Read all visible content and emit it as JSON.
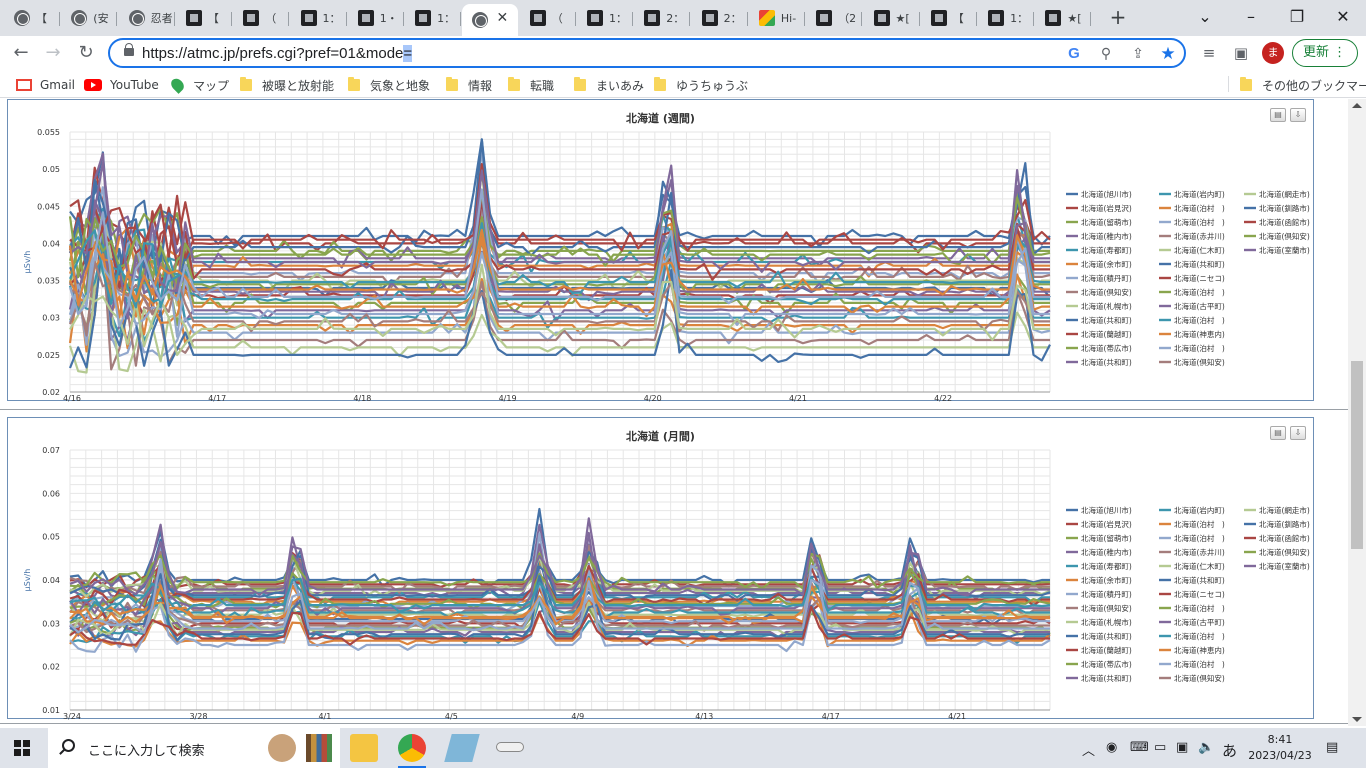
{
  "browser": {
    "tabs": [
      {
        "label": "【",
        "icon": "globe"
      },
      {
        "label": "(安",
        "icon": "globe"
      },
      {
        "label": "忍者",
        "icon": "globe"
      },
      {
        "label": "【",
        "icon": "dark"
      },
      {
        "label": "（",
        "icon": "dark"
      },
      {
        "label": "1：",
        "icon": "dark"
      },
      {
        "label": "1・",
        "icon": "dark"
      },
      {
        "label": "1：",
        "icon": "dark"
      },
      {
        "label": "",
        "icon": "globe",
        "active": true
      },
      {
        "label": "（",
        "icon": "dark"
      },
      {
        "label": "1：",
        "icon": "dark"
      },
      {
        "label": "2：",
        "icon": "dark"
      },
      {
        "label": "2：",
        "icon": "dark"
      },
      {
        "label": "Hi-",
        "icon": "color"
      },
      {
        "label": "（2",
        "icon": "dark"
      },
      {
        "label": "★[",
        "icon": "dark"
      },
      {
        "label": "【",
        "icon": "dark"
      },
      {
        "label": "1：",
        "icon": "dark"
      },
      {
        "label": "★[",
        "icon": "dark"
      }
    ],
    "url_main": "https://atmc.jp/prefs.cgi?pref=01&mode",
    "url_selected": "=",
    "update_label": "更新",
    "avatar_letter": "ま",
    "bookmarks": [
      {
        "label": "Gmail",
        "icon": "gmail"
      },
      {
        "label": "YouTube",
        "icon": "youtube"
      },
      {
        "label": "マップ",
        "icon": "maps"
      },
      {
        "label": "被曝と放射能",
        "icon": "folder"
      },
      {
        "label": "気象と地象",
        "icon": "folder"
      },
      {
        "label": "情報",
        "icon": "folder"
      },
      {
        "label": "転職",
        "icon": "folder"
      },
      {
        "label": "まいあみ",
        "icon": "folder"
      },
      {
        "label": "ゆうちゅうぶ",
        "icon": "folder"
      }
    ],
    "other_bookmarks": "その他のブックマーク"
  },
  "chart_data": [
    {
      "type": "line",
      "title": "北海道 (週間)",
      "ylabel": "μSv/h",
      "ylim": [
        0.02,
        0.055
      ],
      "yticks": [
        "0.055",
        "0.05",
        "0.045",
        "0.04",
        "0.035",
        "0.03",
        "0.025",
        "0.02"
      ],
      "xticks": [
        "4/16",
        "4/17",
        "4/18",
        "4/19",
        "4/20",
        "4/21",
        "4/22"
      ],
      "series_levels": [
        0.041,
        0.04,
        0.039,
        0.038,
        0.0375,
        0.037,
        0.036,
        0.0355,
        0.035,
        0.034,
        0.033,
        0.032,
        0.031,
        0.03,
        0.029,
        0.028,
        0.027,
        0.026,
        0.025,
        0.0365,
        0.0345,
        0.0335,
        0.0325,
        0.0315,
        0.0305,
        0.0295,
        0.0285,
        0.0395,
        0.0405,
        0.0385,
        0.0375,
        0.0348,
        0.0338,
        0.0328
      ],
      "grid": true
    },
    {
      "type": "line",
      "title": "北海道 (月間)",
      "ylabel": "μSv/h",
      "ylim": [
        0.01,
        0.07
      ],
      "yticks": [
        "0.07",
        "0.06",
        "0.05",
        "0.04",
        "0.03",
        "0.02",
        "0.01"
      ],
      "xticks": [
        "3/24",
        "3/28",
        "4/1",
        "4/5",
        "4/9",
        "4/13",
        "4/17",
        "4/21"
      ],
      "series_levels": [
        0.04,
        0.039,
        0.038,
        0.037,
        0.036,
        0.035,
        0.034,
        0.033,
        0.032,
        0.031,
        0.03,
        0.029,
        0.028,
        0.027,
        0.026,
        0.025,
        0.0385,
        0.0375,
        0.0365,
        0.0355,
        0.0345,
        0.0335,
        0.0325,
        0.0315,
        0.0305,
        0.0295,
        0.0285,
        0.0275,
        0.0265,
        0.0395,
        0.0378,
        0.0342,
        0.0312,
        0.0288
      ],
      "grid": true
    }
  ],
  "legend_columns": [
    [
      "北海道(旭川市)",
      "北海道(岩見沢)",
      "北海道(留萌市)",
      "北海道(稚内市)",
      "北海道(寿都町)",
      "北海道(余市町)",
      "北海道(積丹町)",
      "北海道(倶知安)",
      "北海道(札幌市)",
      "北海道(共和町)",
      "北海道(蘭越町)",
      "北海道(帯広市)",
      "北海道(共和町)"
    ],
    [
      "北海道(岩内町)",
      "北海道(泊村　)",
      "北海道(泊村　)",
      "北海道(赤井川)",
      "北海道(仁木町)",
      "北海道(共和町)",
      "北海道(ニセコ)",
      "北海道(泊村　)",
      "北海道(古平町)",
      "北海道(泊村　)",
      "北海道(神恵内)",
      "北海道(泊村　)",
      "北海道(倶知安)"
    ],
    [
      "北海道(網走市)",
      "北海道(釧路市)",
      "北海道(函館市)",
      "北海道(倶知安)",
      "北海道(室蘭市)"
    ]
  ],
  "series_colors": [
    "#4572A7",
    "#AA4643",
    "#89A54E",
    "#80699B",
    "#3D96AE",
    "#DB843D",
    "#92A8CD",
    "#A47D7C",
    "#B5CA92",
    "#4572A7",
    "#AA4643",
    "#89A54E",
    "#80699B",
    "#3D96AE",
    "#DB843D",
    "#92A8CD",
    "#A47D7C",
    "#B5CA92"
  ],
  "taskbar": {
    "search_placeholder": "ここに入力して検索",
    "ime": "あ",
    "time": "8:41",
    "date": "2023/04/23"
  }
}
